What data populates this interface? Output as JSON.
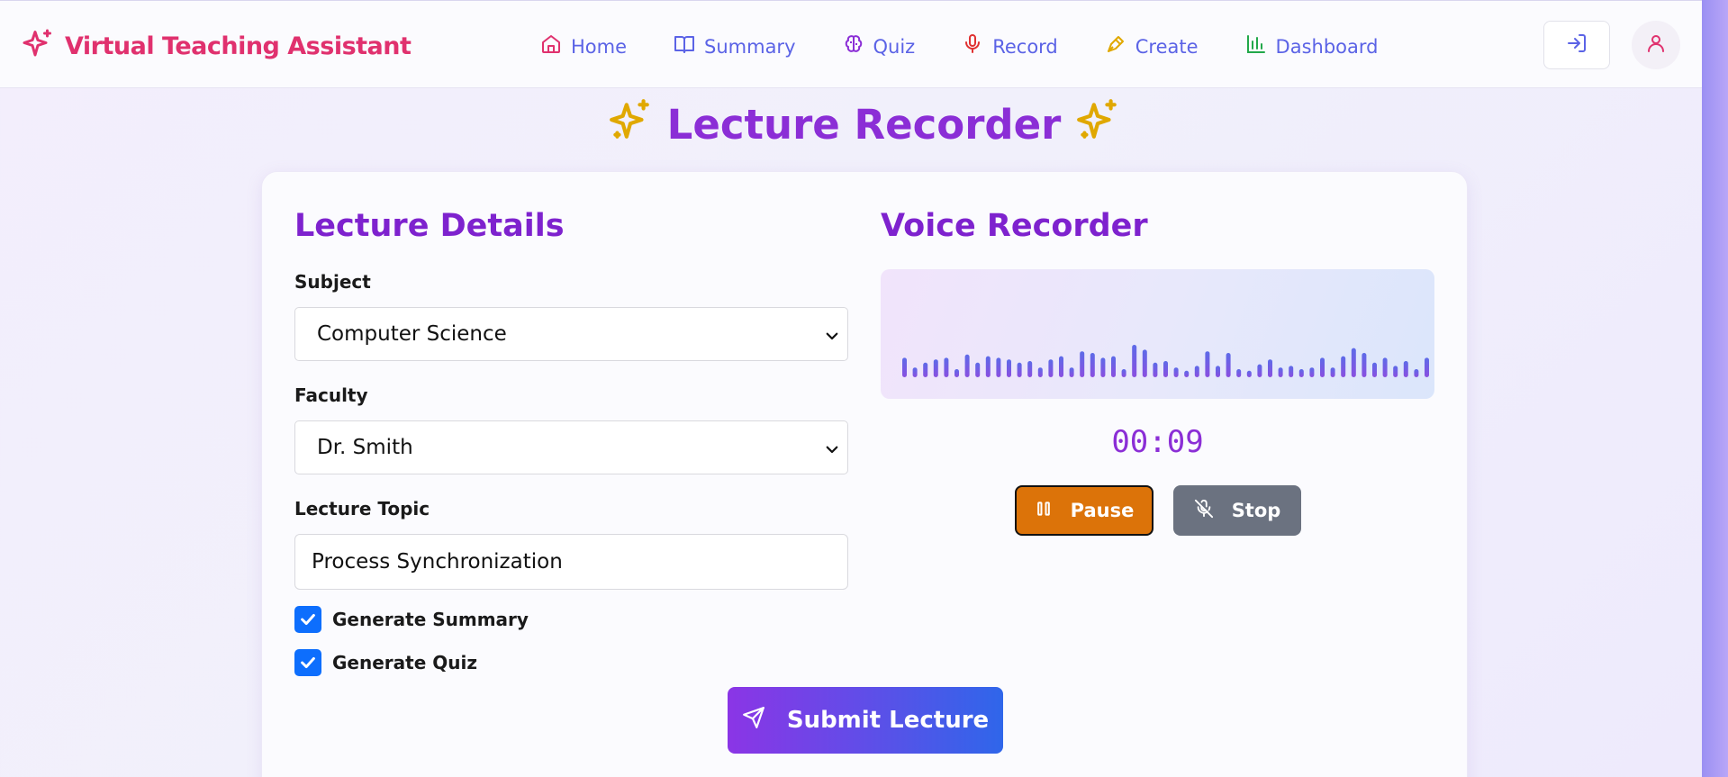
{
  "header": {
    "brand_title": "Virtual Teaching Assistant",
    "nav": [
      {
        "label": "Home",
        "icon": "home-icon",
        "color": "#e0316e"
      },
      {
        "label": "Summary",
        "icon": "book-icon",
        "color": "#5b63e6"
      },
      {
        "label": "Quiz",
        "icon": "brain-icon",
        "color": "#8b2ed6"
      },
      {
        "label": "Record",
        "icon": "mic-icon",
        "color": "#e03131"
      },
      {
        "label": "Create",
        "icon": "pen-icon",
        "color": "#e0a800"
      },
      {
        "label": "Dashboard",
        "icon": "chart-icon",
        "color": "#22a84a"
      }
    ]
  },
  "page": {
    "title": "Lecture Recorder"
  },
  "details": {
    "section_title": "Lecture Details",
    "subject_label": "Subject",
    "subject_value": "Computer Science",
    "faculty_label": "Faculty",
    "faculty_value": "Dr. Smith",
    "topic_label": "Lecture Topic",
    "topic_value": "Process Synchronization",
    "generate_summary_label": "Generate Summary",
    "generate_summary_checked": true,
    "generate_quiz_label": "Generate Quiz",
    "generate_quiz_checked": true
  },
  "recorder": {
    "section_title": "Voice Recorder",
    "timer": "00:09",
    "pause_label": "Pause",
    "stop_label": "Stop",
    "levels": [
      0.6,
      0.3,
      0.45,
      0.55,
      0.6,
      0.25,
      0.7,
      0.45,
      0.65,
      0.6,
      0.55,
      0.45,
      0.5,
      0.3,
      0.55,
      0.65,
      0.3,
      0.8,
      0.75,
      0.6,
      0.65,
      0.25,
      1.0,
      0.85,
      0.45,
      0.5,
      0.3,
      0.2,
      0.35,
      0.8,
      0.35,
      0.75,
      0.25,
      0.2,
      0.4,
      0.55,
      0.3,
      0.35,
      0.25,
      0.3,
      0.6,
      0.3,
      0.65,
      0.9,
      0.75,
      0.45,
      0.6,
      0.35,
      0.5,
      0.25,
      0.6
    ]
  },
  "submit_label": "Submit Lecture",
  "colors": {
    "brand": "#e0316e",
    "accent": "#7e22ce",
    "pause": "#dc7309",
    "stop": "#6b7280",
    "checkbox": "#0d6efd"
  }
}
